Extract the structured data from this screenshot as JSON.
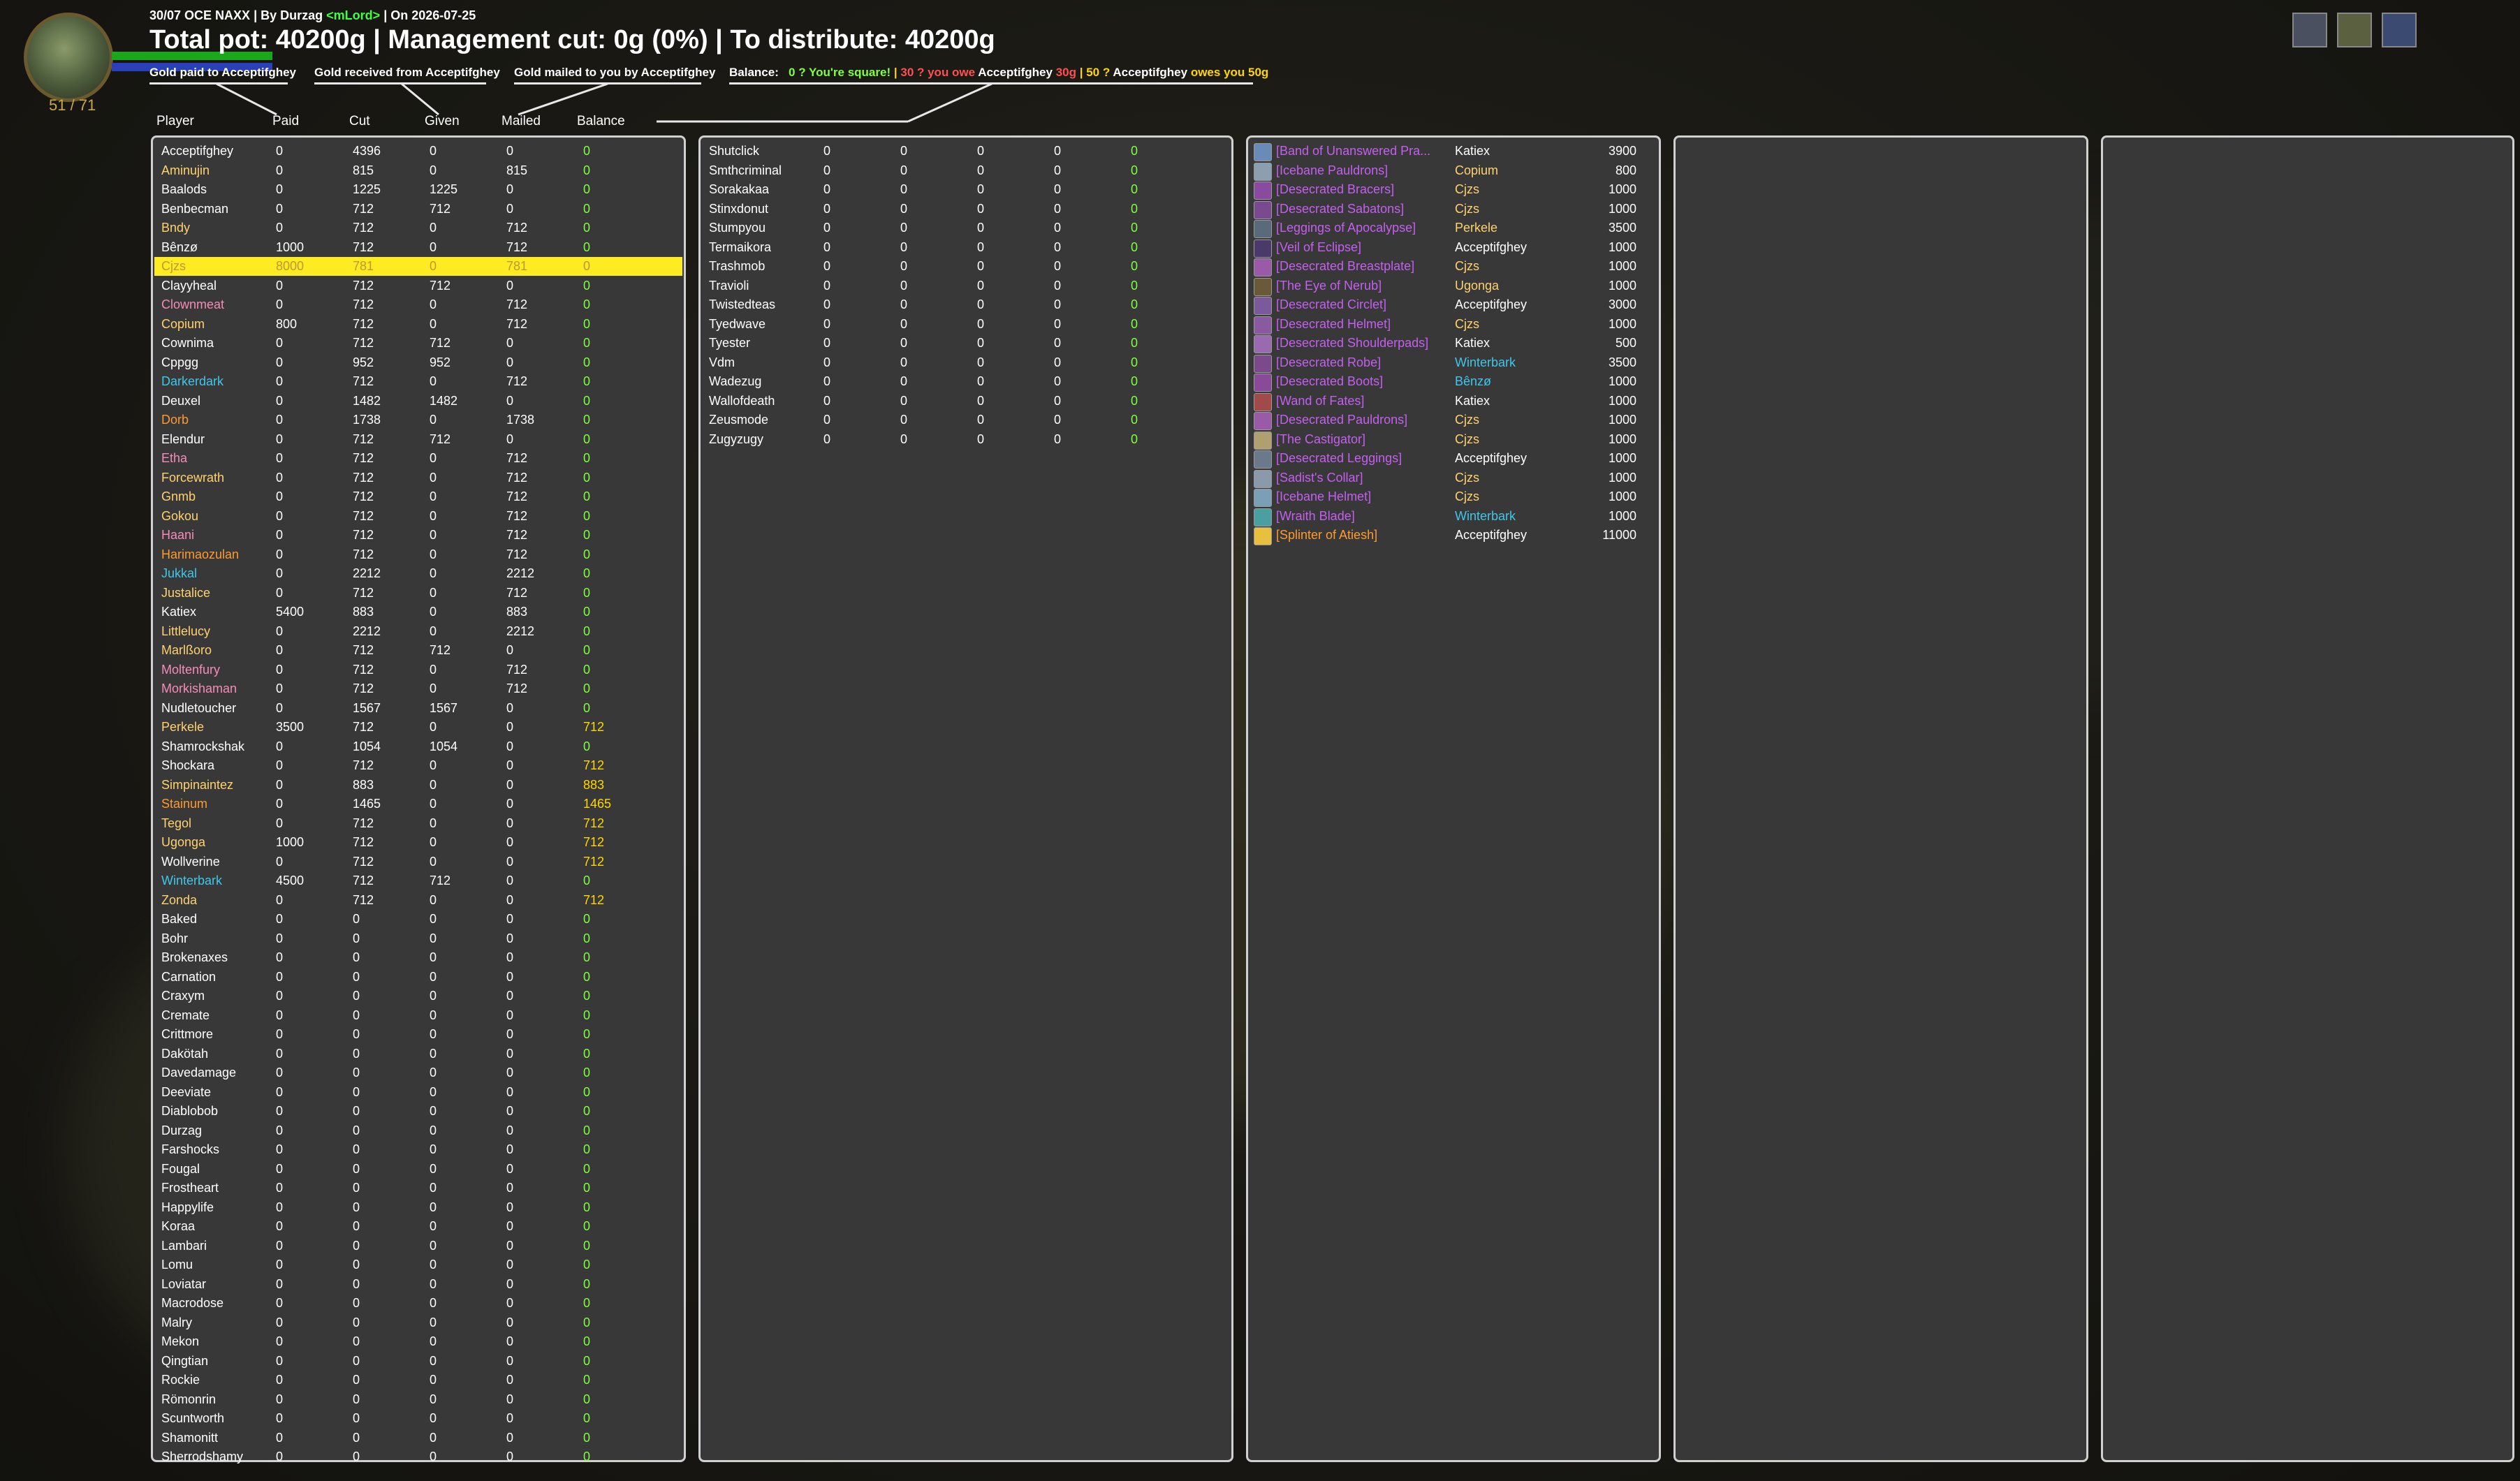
{
  "meta": {
    "raid": "30/07 OCE NAXX",
    "by_label": "| By Durzag",
    "guild_tag": "<mLord>",
    "date_label": "| On 2026-07-25"
  },
  "headline": "Total pot: 40200g | Management cut: 0g (0%) | To distribute: 40200g",
  "hp_text": "51 / 71",
  "legend": {
    "paid": "Gold paid to Acceptifghey",
    "received": "Gold received from Acceptifghey",
    "mailed": "Gold mailed to you by Acceptifghey",
    "balance_label": "Balance:",
    "square": "0 ? You're square!",
    "sep": "|",
    "owe_prefix": "30 ? you owe",
    "owe_name": "Acceptifghey",
    "owe_amount": "30g",
    "owed_prefix": "50 ?",
    "owed_name": "Acceptifghey",
    "owed_suffix": "owes you 50g"
  },
  "columns": [
    "Player",
    "Paid",
    "Cut",
    "Given",
    "Mailed",
    "Balance"
  ],
  "colors": {
    "white": "#ffffff",
    "gold": "#ffd26e",
    "cyan": "#3fc7eb",
    "pink": "#f58cba",
    "orange": "#ff9a2e",
    "purple": "#c55ff0",
    "yellow": "#fff569",
    "green": "#a3e44a",
    "balance_zero": "#7fff3f",
    "balance_pos": "#ffd700"
  },
  "players_left": [
    {
      "name": "Acceptifghey",
      "c": "white",
      "paid": "0",
      "cut": "4396",
      "given": "0",
      "mailed": "0",
      "balance": "0"
    },
    {
      "name": "Aminujin",
      "c": "gold",
      "paid": "0",
      "cut": "815",
      "given": "0",
      "mailed": "815",
      "balance": "0"
    },
    {
      "name": "Baalods",
      "c": "white",
      "paid": "0",
      "cut": "1225",
      "given": "1225",
      "mailed": "0",
      "balance": "0"
    },
    {
      "name": "Benbecman",
      "c": "white",
      "paid": "0",
      "cut": "712",
      "given": "712",
      "mailed": "0",
      "balance": "0"
    },
    {
      "name": "Bndy",
      "c": "gold",
      "paid": "0",
      "cut": "712",
      "given": "0",
      "mailed": "712",
      "balance": "0"
    },
    {
      "name": "Bênzø",
      "c": "white",
      "paid": "1000",
      "cut": "712",
      "given": "0",
      "mailed": "712",
      "balance": "0"
    },
    {
      "name": "Cjzs",
      "c": "white",
      "paid": "8000",
      "cut": "781",
      "given": "0",
      "mailed": "781",
      "balance": "0",
      "hl": true
    },
    {
      "name": "Clayyheal",
      "c": "white",
      "paid": "0",
      "cut": "712",
      "given": "712",
      "mailed": "0",
      "balance": "0"
    },
    {
      "name": "Clownmeat",
      "c": "pink",
      "paid": "0",
      "cut": "712",
      "given": "0",
      "mailed": "712",
      "balance": "0"
    },
    {
      "name": "Copium",
      "c": "gold",
      "paid": "800",
      "cut": "712",
      "given": "0",
      "mailed": "712",
      "balance": "0"
    },
    {
      "name": "Cownima",
      "c": "white",
      "paid": "0",
      "cut": "712",
      "given": "712",
      "mailed": "0",
      "balance": "0"
    },
    {
      "name": "Cppgg",
      "c": "white",
      "paid": "0",
      "cut": "952",
      "given": "952",
      "mailed": "0",
      "balance": "0"
    },
    {
      "name": "Darkerdark",
      "c": "cyan",
      "paid": "0",
      "cut": "712",
      "given": "0",
      "mailed": "712",
      "balance": "0"
    },
    {
      "name": "Deuxel",
      "c": "white",
      "paid": "0",
      "cut": "1482",
      "given": "1482",
      "mailed": "0",
      "balance": "0"
    },
    {
      "name": "Dorb",
      "c": "orange",
      "paid": "0",
      "cut": "1738",
      "given": "0",
      "mailed": "1738",
      "balance": "0"
    },
    {
      "name": "Elendur",
      "c": "white",
      "paid": "0",
      "cut": "712",
      "given": "712",
      "mailed": "0",
      "balance": "0"
    },
    {
      "name": "Etha",
      "c": "pink",
      "paid": "0",
      "cut": "712",
      "given": "0",
      "mailed": "712",
      "balance": "0"
    },
    {
      "name": "Forcewrath",
      "c": "gold",
      "paid": "0",
      "cut": "712",
      "given": "0",
      "mailed": "712",
      "balance": "0"
    },
    {
      "name": "Gnmb",
      "c": "gold",
      "paid": "0",
      "cut": "712",
      "given": "0",
      "mailed": "712",
      "balance": "0"
    },
    {
      "name": "Gokou",
      "c": "gold",
      "paid": "0",
      "cut": "712",
      "given": "0",
      "mailed": "712",
      "balance": "0"
    },
    {
      "name": "Haani",
      "c": "pink",
      "paid": "0",
      "cut": "712",
      "given": "0",
      "mailed": "712",
      "balance": "0"
    },
    {
      "name": "Harimaozulan",
      "c": "orange",
      "paid": "0",
      "cut": "712",
      "given": "0",
      "mailed": "712",
      "balance": "0"
    },
    {
      "name": "Jukkal",
      "c": "cyan",
      "paid": "0",
      "cut": "2212",
      "given": "0",
      "mailed": "2212",
      "balance": "0"
    },
    {
      "name": "Justalice",
      "c": "gold",
      "paid": "0",
      "cut": "712",
      "given": "0",
      "mailed": "712",
      "balance": "0"
    },
    {
      "name": "Katiex",
      "c": "white",
      "paid": "5400",
      "cut": "883",
      "given": "0",
      "mailed": "883",
      "balance": "0"
    },
    {
      "name": "Littlelucy",
      "c": "gold",
      "paid": "0",
      "cut": "2212",
      "given": "0",
      "mailed": "2212",
      "balance": "0"
    },
    {
      "name": "Marlßoro",
      "c": "gold",
      "paid": "0",
      "cut": "712",
      "given": "712",
      "mailed": "0",
      "balance": "0"
    },
    {
      "name": "Moltenfury",
      "c": "pink",
      "paid": "0",
      "cut": "712",
      "given": "0",
      "mailed": "712",
      "balance": "0"
    },
    {
      "name": "Morkishaman",
      "c": "pink",
      "paid": "0",
      "cut": "712",
      "given": "0",
      "mailed": "712",
      "balance": "0"
    },
    {
      "name": "Nudletoucher",
      "c": "white",
      "paid": "0",
      "cut": "1567",
      "given": "1567",
      "mailed": "0",
      "balance": "0"
    },
    {
      "name": "Perkele",
      "c": "gold",
      "paid": "3500",
      "cut": "712",
      "given": "0",
      "mailed": "0",
      "balance": "712"
    },
    {
      "name": "Shamrockshak",
      "c": "white",
      "paid": "0",
      "cut": "1054",
      "given": "1054",
      "mailed": "0",
      "balance": "0"
    },
    {
      "name": "Shockara",
      "c": "white",
      "paid": "0",
      "cut": "712",
      "given": "0",
      "mailed": "0",
      "balance": "712"
    },
    {
      "name": "Simpinaintez",
      "c": "gold",
      "paid": "0",
      "cut": "883",
      "given": "0",
      "mailed": "0",
      "balance": "883"
    },
    {
      "name": "Stainum",
      "c": "orange",
      "paid": "0",
      "cut": "1465",
      "given": "0",
      "mailed": "0",
      "balance": "1465"
    },
    {
      "name": "Tegol",
      "c": "gold",
      "paid": "0",
      "cut": "712",
      "given": "0",
      "mailed": "0",
      "balance": "712"
    },
    {
      "name": "Ugonga",
      "c": "gold",
      "paid": "1000",
      "cut": "712",
      "given": "0",
      "mailed": "0",
      "balance": "712"
    },
    {
      "name": "Wollverine",
      "c": "white",
      "paid": "0",
      "cut": "712",
      "given": "0",
      "mailed": "0",
      "balance": "712"
    },
    {
      "name": "Winterbark",
      "c": "cyan",
      "paid": "4500",
      "cut": "712",
      "given": "712",
      "mailed": "0",
      "balance": "0"
    },
    {
      "name": "Zonda",
      "c": "gold",
      "paid": "0",
      "cut": "712",
      "given": "0",
      "mailed": "0",
      "balance": "712"
    },
    {
      "name": "Baked",
      "c": "white",
      "paid": "0",
      "cut": "0",
      "given": "0",
      "mailed": "0",
      "balance": "0"
    },
    {
      "name": "Bohr",
      "c": "white",
      "paid": "0",
      "cut": "0",
      "given": "0",
      "mailed": "0",
      "balance": "0"
    },
    {
      "name": "Brokenaxes",
      "c": "white",
      "paid": "0",
      "cut": "0",
      "given": "0",
      "mailed": "0",
      "balance": "0"
    },
    {
      "name": "Carnation",
      "c": "white",
      "paid": "0",
      "cut": "0",
      "given": "0",
      "mailed": "0",
      "balance": "0"
    },
    {
      "name": "Craxym",
      "c": "white",
      "paid": "0",
      "cut": "0",
      "given": "0",
      "mailed": "0",
      "balance": "0"
    },
    {
      "name": "Cremate",
      "c": "white",
      "paid": "0",
      "cut": "0",
      "given": "0",
      "mailed": "0",
      "balance": "0"
    },
    {
      "name": "Crittmore",
      "c": "white",
      "paid": "0",
      "cut": "0",
      "given": "0",
      "mailed": "0",
      "balance": "0"
    },
    {
      "name": "Dakötah",
      "c": "white",
      "paid": "0",
      "cut": "0",
      "given": "0",
      "mailed": "0",
      "balance": "0"
    },
    {
      "name": "Davedamage",
      "c": "white",
      "paid": "0",
      "cut": "0",
      "given": "0",
      "mailed": "0",
      "balance": "0"
    },
    {
      "name": "Deeviate",
      "c": "white",
      "paid": "0",
      "cut": "0",
      "given": "0",
      "mailed": "0",
      "balance": "0"
    },
    {
      "name": "Diablobob",
      "c": "white",
      "paid": "0",
      "cut": "0",
      "given": "0",
      "mailed": "0",
      "balance": "0"
    },
    {
      "name": "Durzag",
      "c": "white",
      "paid": "0",
      "cut": "0",
      "given": "0",
      "mailed": "0",
      "balance": "0"
    },
    {
      "name": "Farshocks",
      "c": "white",
      "paid": "0",
      "cut": "0",
      "given": "0",
      "mailed": "0",
      "balance": "0"
    },
    {
      "name": "Fougal",
      "c": "white",
      "paid": "0",
      "cut": "0",
      "given": "0",
      "mailed": "0",
      "balance": "0"
    },
    {
      "name": "Frostheart",
      "c": "white",
      "paid": "0",
      "cut": "0",
      "given": "0",
      "mailed": "0",
      "balance": "0"
    },
    {
      "name": "Happylife",
      "c": "white",
      "paid": "0",
      "cut": "0",
      "given": "0",
      "mailed": "0",
      "balance": "0"
    },
    {
      "name": "Koraa",
      "c": "white",
      "paid": "0",
      "cut": "0",
      "given": "0",
      "mailed": "0",
      "balance": "0"
    },
    {
      "name": "Lambari",
      "c": "white",
      "paid": "0",
      "cut": "0",
      "given": "0",
      "mailed": "0",
      "balance": "0"
    },
    {
      "name": "Lomu",
      "c": "white",
      "paid": "0",
      "cut": "0",
      "given": "0",
      "mailed": "0",
      "balance": "0"
    },
    {
      "name": "Loviatar",
      "c": "white",
      "paid": "0",
      "cut": "0",
      "given": "0",
      "mailed": "0",
      "balance": "0"
    },
    {
      "name": "Macrodose",
      "c": "white",
      "paid": "0",
      "cut": "0",
      "given": "0",
      "mailed": "0",
      "balance": "0"
    },
    {
      "name": "Malry",
      "c": "white",
      "paid": "0",
      "cut": "0",
      "given": "0",
      "mailed": "0",
      "balance": "0"
    },
    {
      "name": "Mekon",
      "c": "white",
      "paid": "0",
      "cut": "0",
      "given": "0",
      "mailed": "0",
      "balance": "0"
    },
    {
      "name": "Qingtian",
      "c": "white",
      "paid": "0",
      "cut": "0",
      "given": "0",
      "mailed": "0",
      "balance": "0"
    },
    {
      "name": "Rockie",
      "c": "white",
      "paid": "0",
      "cut": "0",
      "given": "0",
      "mailed": "0",
      "balance": "0"
    },
    {
      "name": "Römonrin",
      "c": "white",
      "paid": "0",
      "cut": "0",
      "given": "0",
      "mailed": "0",
      "balance": "0"
    },
    {
      "name": "Scuntworth",
      "c": "white",
      "paid": "0",
      "cut": "0",
      "given": "0",
      "mailed": "0",
      "balance": "0"
    },
    {
      "name": "Shamonitt",
      "c": "white",
      "paid": "0",
      "cut": "0",
      "given": "0",
      "mailed": "0",
      "balance": "0"
    },
    {
      "name": "Sherrodshamy",
      "c": "white",
      "paid": "0",
      "cut": "0",
      "given": "0",
      "mailed": "0",
      "balance": "0"
    }
  ],
  "players_mid": [
    {
      "name": "Shutclick",
      "c": "white",
      "paid": "0",
      "cut": "0",
      "given": "0",
      "mailed": "0",
      "balance": "0"
    },
    {
      "name": "Smthcriminal",
      "c": "white",
      "paid": "0",
      "cut": "0",
      "given": "0",
      "mailed": "0",
      "balance": "0"
    },
    {
      "name": "Sorakakaa",
      "c": "white",
      "paid": "0",
      "cut": "0",
      "given": "0",
      "mailed": "0",
      "balance": "0"
    },
    {
      "name": "Stinxdonut",
      "c": "white",
      "paid": "0",
      "cut": "0",
      "given": "0",
      "mailed": "0",
      "balance": "0"
    },
    {
      "name": "Stumpyou",
      "c": "white",
      "paid": "0",
      "cut": "0",
      "given": "0",
      "mailed": "0",
      "balance": "0"
    },
    {
      "name": "Termaikora",
      "c": "white",
      "paid": "0",
      "cut": "0",
      "given": "0",
      "mailed": "0",
      "balance": "0"
    },
    {
      "name": "Trashmob",
      "c": "white",
      "paid": "0",
      "cut": "0",
      "given": "0",
      "mailed": "0",
      "balance": "0"
    },
    {
      "name": "Travioli",
      "c": "white",
      "paid": "0",
      "cut": "0",
      "given": "0",
      "mailed": "0",
      "balance": "0"
    },
    {
      "name": "Twistedteas",
      "c": "white",
      "paid": "0",
      "cut": "0",
      "given": "0",
      "mailed": "0",
      "balance": "0"
    },
    {
      "name": "Tyedwave",
      "c": "white",
      "paid": "0",
      "cut": "0",
      "given": "0",
      "mailed": "0",
      "balance": "0"
    },
    {
      "name": "Tyester",
      "c": "white",
      "paid": "0",
      "cut": "0",
      "given": "0",
      "mailed": "0",
      "balance": "0"
    },
    {
      "name": "Vdm",
      "c": "white",
      "paid": "0",
      "cut": "0",
      "given": "0",
      "mailed": "0",
      "balance": "0"
    },
    {
      "name": "Wadezug",
      "c": "white",
      "paid": "0",
      "cut": "0",
      "given": "0",
      "mailed": "0",
      "balance": "0"
    },
    {
      "name": "Wallofdeath",
      "c": "white",
      "paid": "0",
      "cut": "0",
      "given": "0",
      "mailed": "0",
      "balance": "0"
    },
    {
      "name": "Zeusmode",
      "c": "white",
      "paid": "0",
      "cut": "0",
      "given": "0",
      "mailed": "0",
      "balance": "0"
    },
    {
      "name": "Zugyzugy",
      "c": "white",
      "paid": "0",
      "cut": "0",
      "given": "0",
      "mailed": "0",
      "balance": "0"
    }
  ],
  "loot": [
    {
      "item": "[Band of Unanswered Pra...",
      "ic": "#6a8ab8",
      "winner": "Katiex",
      "wc": "white",
      "amount": "3900"
    },
    {
      "item": "[Icebane Pauldrons]",
      "ic": "#8aa0b0",
      "winner": "Copium",
      "wc": "gold",
      "amount": "800"
    },
    {
      "item": "[Desecrated Bracers]",
      "ic": "#8a4aa0",
      "winner": "Cjzs",
      "wc": "gold",
      "amount": "1000"
    },
    {
      "item": "[Desecrated Sabatons]",
      "ic": "#7a4a90",
      "winner": "Cjzs",
      "wc": "gold",
      "amount": "1000"
    },
    {
      "item": "[Leggings of Apocalypse]",
      "ic": "#5a6a7a",
      "winner": "Perkele",
      "wc": "gold",
      "amount": "3500"
    },
    {
      "item": "[Veil of Eclipse]",
      "ic": "#4a3a6a",
      "winner": "Acceptifghey",
      "wc": "white",
      "amount": "1000"
    },
    {
      "item": "[Desecrated Breastplate]",
      "ic": "#9a5aa8",
      "winner": "Cjzs",
      "wc": "gold",
      "amount": "1000"
    },
    {
      "item": "[The Eye of Nerub]",
      "ic": "#6a5a3a",
      "winner": "Ugonga",
      "wc": "gold",
      "amount": "1000"
    },
    {
      "item": "[Desecrated Circlet]",
      "ic": "#7a5a9a",
      "winner": "Acceptifghey",
      "wc": "white",
      "amount": "3000"
    },
    {
      "item": "[Desecrated Helmet]",
      "ic": "#8a5aa0",
      "winner": "Cjzs",
      "wc": "gold",
      "amount": "1000"
    },
    {
      "item": "[Desecrated Shoulderpads]",
      "ic": "#9a6ab0",
      "winner": "Katiex",
      "wc": "white",
      "amount": "500"
    },
    {
      "item": "[Desecrated Robe]",
      "ic": "#7a4a8a",
      "winner": "Winterbark",
      "wc": "cyan",
      "amount": "3500"
    },
    {
      "item": "[Desecrated Boots]",
      "ic": "#8a4a9a",
      "winner": "Bênzø",
      "wc": "cyan",
      "amount": "1000"
    },
    {
      "item": "[Wand of Fates]",
      "ic": "#a04a4a",
      "winner": "Katiex",
      "wc": "white",
      "amount": "1000"
    },
    {
      "item": "[Desecrated Pauldrons]",
      "ic": "#9a5aa8",
      "winner": "Cjzs",
      "wc": "gold",
      "amount": "1000"
    },
    {
      "item": "[The Castigator]",
      "ic": "#b0a070",
      "winner": "Cjzs",
      "wc": "gold",
      "amount": "1000"
    },
    {
      "item": "[Desecrated Leggings]",
      "ic": "#6a7a8a",
      "winner": "Acceptifghey",
      "wc": "white",
      "amount": "1000"
    },
    {
      "item": "[Sadist's Collar]",
      "ic": "#8a9aaa",
      "winner": "Cjzs",
      "wc": "gold",
      "amount": "1000"
    },
    {
      "item": "[Icebane Helmet]",
      "ic": "#7aa0b8",
      "winner": "Cjzs",
      "wc": "gold",
      "amount": "1000"
    },
    {
      "item": "[Wraith Blade]",
      "ic": "#4aa0a0",
      "winner": "Winterbark",
      "wc": "cyan",
      "amount": "1000"
    },
    {
      "item": "[Splinter of Atiesh]",
      "ic": "#e8c040",
      "winner": "Acceptifghey",
      "wc": "white",
      "amount": "11000",
      "legendary": true
    }
  ]
}
